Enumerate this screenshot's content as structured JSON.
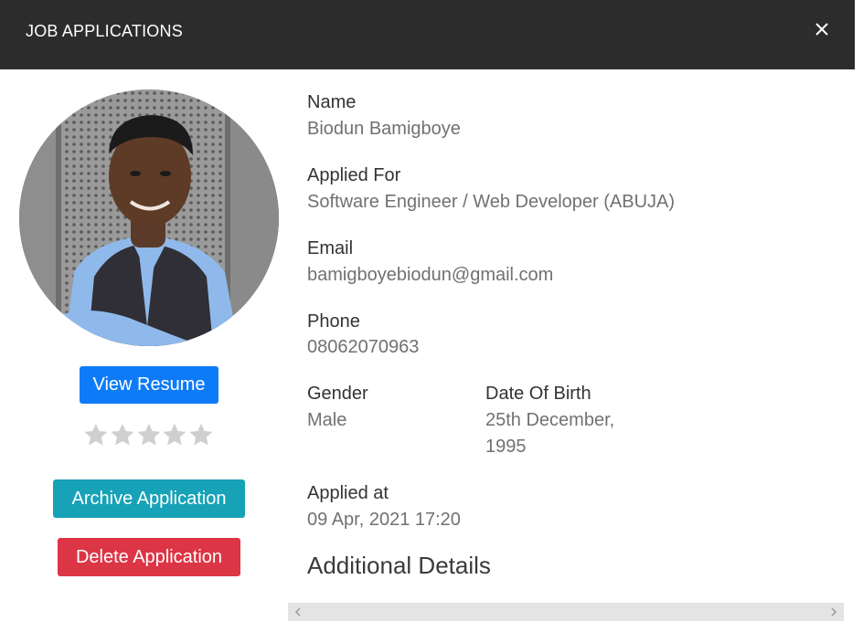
{
  "modal": {
    "title": "JOB APPLICATIONS",
    "close_icon": "close-icon"
  },
  "applicant": {
    "photo_alt": "applicant-photo",
    "actions": {
      "view_resume": "View Resume",
      "archive": "Archive Application",
      "delete": "Delete Application"
    },
    "rating": {
      "value": 0,
      "max": 5
    },
    "fields": {
      "name_label": "Name",
      "name_value": "Biodun Bamigboye",
      "applied_for_label": "Applied For",
      "applied_for_value": "Software Engineer / Web Developer (ABUJA)",
      "email_label": "Email",
      "email_value": "bamigboyebiodun@gmail.com",
      "phone_label": "Phone",
      "phone_value": "08062070963",
      "gender_label": "Gender",
      "gender_value": "Male",
      "dob_label": "Date Of Birth",
      "dob_value_line1": "25th December,",
      "dob_value_line2": "1995",
      "applied_at_label": "Applied at",
      "applied_at_value": "09 Apr, 2021 17:20"
    },
    "additional_details_title": "Additional Details"
  },
  "colors": {
    "header_bg": "#2c2c2c",
    "primary": "#0d7bf7",
    "info": "#17a2b8",
    "danger": "#dc3545",
    "star_empty": "#cfcfcf"
  }
}
